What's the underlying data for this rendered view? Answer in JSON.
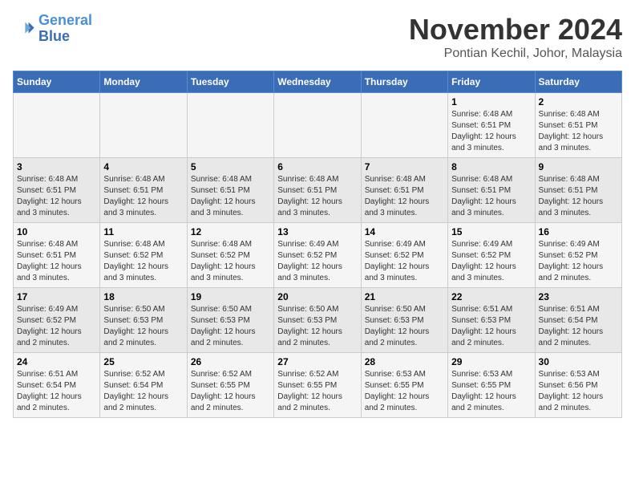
{
  "logo": {
    "line1": "General",
    "line2": "Blue"
  },
  "title": "November 2024",
  "subtitle": "Pontian Kechil, Johor, Malaysia",
  "days_of_week": [
    "Sunday",
    "Monday",
    "Tuesday",
    "Wednesday",
    "Thursday",
    "Friday",
    "Saturday"
  ],
  "weeks": [
    [
      {
        "day": "",
        "detail": ""
      },
      {
        "day": "",
        "detail": ""
      },
      {
        "day": "",
        "detail": ""
      },
      {
        "day": "",
        "detail": ""
      },
      {
        "day": "",
        "detail": ""
      },
      {
        "day": "1",
        "detail": "Sunrise: 6:48 AM\nSunset: 6:51 PM\nDaylight: 12 hours and 3 minutes."
      },
      {
        "day": "2",
        "detail": "Sunrise: 6:48 AM\nSunset: 6:51 PM\nDaylight: 12 hours and 3 minutes."
      }
    ],
    [
      {
        "day": "3",
        "detail": "Sunrise: 6:48 AM\nSunset: 6:51 PM\nDaylight: 12 hours and 3 minutes."
      },
      {
        "day": "4",
        "detail": "Sunrise: 6:48 AM\nSunset: 6:51 PM\nDaylight: 12 hours and 3 minutes."
      },
      {
        "day": "5",
        "detail": "Sunrise: 6:48 AM\nSunset: 6:51 PM\nDaylight: 12 hours and 3 minutes."
      },
      {
        "day": "6",
        "detail": "Sunrise: 6:48 AM\nSunset: 6:51 PM\nDaylight: 12 hours and 3 minutes."
      },
      {
        "day": "7",
        "detail": "Sunrise: 6:48 AM\nSunset: 6:51 PM\nDaylight: 12 hours and 3 minutes."
      },
      {
        "day": "8",
        "detail": "Sunrise: 6:48 AM\nSunset: 6:51 PM\nDaylight: 12 hours and 3 minutes."
      },
      {
        "day": "9",
        "detail": "Sunrise: 6:48 AM\nSunset: 6:51 PM\nDaylight: 12 hours and 3 minutes."
      }
    ],
    [
      {
        "day": "10",
        "detail": "Sunrise: 6:48 AM\nSunset: 6:51 PM\nDaylight: 12 hours and 3 minutes."
      },
      {
        "day": "11",
        "detail": "Sunrise: 6:48 AM\nSunset: 6:52 PM\nDaylight: 12 hours and 3 minutes."
      },
      {
        "day": "12",
        "detail": "Sunrise: 6:48 AM\nSunset: 6:52 PM\nDaylight: 12 hours and 3 minutes."
      },
      {
        "day": "13",
        "detail": "Sunrise: 6:49 AM\nSunset: 6:52 PM\nDaylight: 12 hours and 3 minutes."
      },
      {
        "day": "14",
        "detail": "Sunrise: 6:49 AM\nSunset: 6:52 PM\nDaylight: 12 hours and 3 minutes."
      },
      {
        "day": "15",
        "detail": "Sunrise: 6:49 AM\nSunset: 6:52 PM\nDaylight: 12 hours and 3 minutes."
      },
      {
        "day": "16",
        "detail": "Sunrise: 6:49 AM\nSunset: 6:52 PM\nDaylight: 12 hours and 2 minutes."
      }
    ],
    [
      {
        "day": "17",
        "detail": "Sunrise: 6:49 AM\nSunset: 6:52 PM\nDaylight: 12 hours and 2 minutes."
      },
      {
        "day": "18",
        "detail": "Sunrise: 6:50 AM\nSunset: 6:53 PM\nDaylight: 12 hours and 2 minutes."
      },
      {
        "day": "19",
        "detail": "Sunrise: 6:50 AM\nSunset: 6:53 PM\nDaylight: 12 hours and 2 minutes."
      },
      {
        "day": "20",
        "detail": "Sunrise: 6:50 AM\nSunset: 6:53 PM\nDaylight: 12 hours and 2 minutes."
      },
      {
        "day": "21",
        "detail": "Sunrise: 6:50 AM\nSunset: 6:53 PM\nDaylight: 12 hours and 2 minutes."
      },
      {
        "day": "22",
        "detail": "Sunrise: 6:51 AM\nSunset: 6:53 PM\nDaylight: 12 hours and 2 minutes."
      },
      {
        "day": "23",
        "detail": "Sunrise: 6:51 AM\nSunset: 6:54 PM\nDaylight: 12 hours and 2 minutes."
      }
    ],
    [
      {
        "day": "24",
        "detail": "Sunrise: 6:51 AM\nSunset: 6:54 PM\nDaylight: 12 hours and 2 minutes."
      },
      {
        "day": "25",
        "detail": "Sunrise: 6:52 AM\nSunset: 6:54 PM\nDaylight: 12 hours and 2 minutes."
      },
      {
        "day": "26",
        "detail": "Sunrise: 6:52 AM\nSunset: 6:55 PM\nDaylight: 12 hours and 2 minutes."
      },
      {
        "day": "27",
        "detail": "Sunrise: 6:52 AM\nSunset: 6:55 PM\nDaylight: 12 hours and 2 minutes."
      },
      {
        "day": "28",
        "detail": "Sunrise: 6:53 AM\nSunset: 6:55 PM\nDaylight: 12 hours and 2 minutes."
      },
      {
        "day": "29",
        "detail": "Sunrise: 6:53 AM\nSunset: 6:55 PM\nDaylight: 12 hours and 2 minutes."
      },
      {
        "day": "30",
        "detail": "Sunrise: 6:53 AM\nSunset: 6:56 PM\nDaylight: 12 hours and 2 minutes."
      }
    ]
  ]
}
